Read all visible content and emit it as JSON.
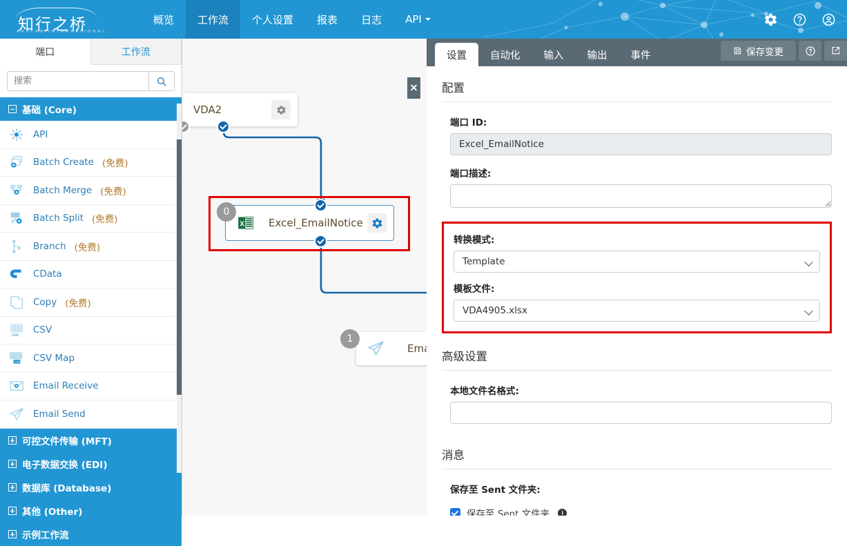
{
  "header": {
    "logo_cn": "知行之桥",
    "logo_sub": "ARCLER INTERNATIONAL",
    "nav": [
      {
        "label": "概览",
        "active": false
      },
      {
        "label": "工作流",
        "active": true
      },
      {
        "label": "个人设置",
        "active": false
      },
      {
        "label": "报表",
        "active": false
      },
      {
        "label": "日志",
        "active": false
      },
      {
        "label": "API",
        "active": false,
        "caret": true
      }
    ],
    "icons": [
      "gear-icon",
      "help-circle-icon",
      "user-account-icon"
    ],
    "bg_color": "#2196d3",
    "active_color": "#1b82bd"
  },
  "sidebar": {
    "tabs": [
      {
        "label": "端口",
        "active": true
      },
      {
        "label": "工作流",
        "active": false
      }
    ],
    "search": {
      "value": "",
      "placeholder": "搜索"
    },
    "groups": [
      {
        "label": "基础 (Core)",
        "expanded": true
      },
      {
        "label": "可控文件传输 (MFT)",
        "expanded": false
      },
      {
        "label": "电子数据交换 (EDI)",
        "expanded": false
      },
      {
        "label": "数据库 (Database)",
        "expanded": false
      },
      {
        "label": "其他 (Other)",
        "expanded": false
      },
      {
        "label": "示例工作流",
        "expanded": false
      }
    ],
    "ports": [
      {
        "name": "API",
        "fee": "",
        "icon": "api-icon"
      },
      {
        "name": "Batch Create",
        "fee": "(免费)",
        "icon": "batch-create-icon"
      },
      {
        "name": "Batch Merge",
        "fee": "(免费)",
        "icon": "batch-merge-icon"
      },
      {
        "name": "Batch Split",
        "fee": "(免费)",
        "icon": "batch-split-icon"
      },
      {
        "name": "Branch",
        "fee": "(免费)",
        "icon": "branch-icon"
      },
      {
        "name": "CData",
        "fee": "",
        "icon": "cdata-icon"
      },
      {
        "name": "Copy",
        "fee": "(免费)",
        "icon": "copy-icon"
      },
      {
        "name": "CSV",
        "fee": "",
        "icon": "csv-icon"
      },
      {
        "name": "CSV Map",
        "fee": "",
        "icon": "csv-map-icon"
      },
      {
        "name": "Email Receive",
        "fee": "",
        "icon": "email-receive-icon"
      },
      {
        "name": "Email Send",
        "fee": "",
        "icon": "email-send-icon"
      }
    ]
  },
  "canvas": {
    "close_label": "✕",
    "nodes": [
      {
        "name": "VDA2",
        "badge": "",
        "icon": ""
      },
      {
        "name": "Excel_EmailNotice",
        "badge": "0",
        "icon": "excel-icon",
        "selected": true
      },
      {
        "name": "Email",
        "badge": "1",
        "icon": "email-send-icon"
      }
    ]
  },
  "right_panel": {
    "tabs": [
      {
        "label": "设置",
        "active": true
      },
      {
        "label": "自动化",
        "active": false
      },
      {
        "label": "输入",
        "active": false
      },
      {
        "label": "输出",
        "active": false
      },
      {
        "label": "事件",
        "active": false
      }
    ],
    "save_label": "保存变更",
    "help_label": "?",
    "popout_label": "↗",
    "sections": {
      "config": {
        "title": "配置",
        "port_id_label": "端口 ID:",
        "port_id_value": "Excel_EmailNotice",
        "port_desc_label": "端口描述:",
        "port_desc_value": "",
        "convert_mode_label": "转换模式:",
        "convert_mode_value": "Template",
        "convert_mode_options": [
          "Template"
        ],
        "template_file_label": "模板文件:",
        "template_file_value": "VDA4905.xlsx",
        "template_file_options": [
          "VDA4905.xlsx"
        ]
      },
      "advanced": {
        "title": "高级设置",
        "local_filename_label": "本地文件名格式:",
        "local_filename_value": ""
      },
      "message": {
        "title": "消息",
        "sent_folder_label": "保存至 Sent 文件夹:",
        "sent_folder_checkbox_label": "保存至 Sent 文件夹",
        "sent_folder_checked": true,
        "info_icon": "i"
      }
    },
    "highlight_color": "#e00000"
  }
}
